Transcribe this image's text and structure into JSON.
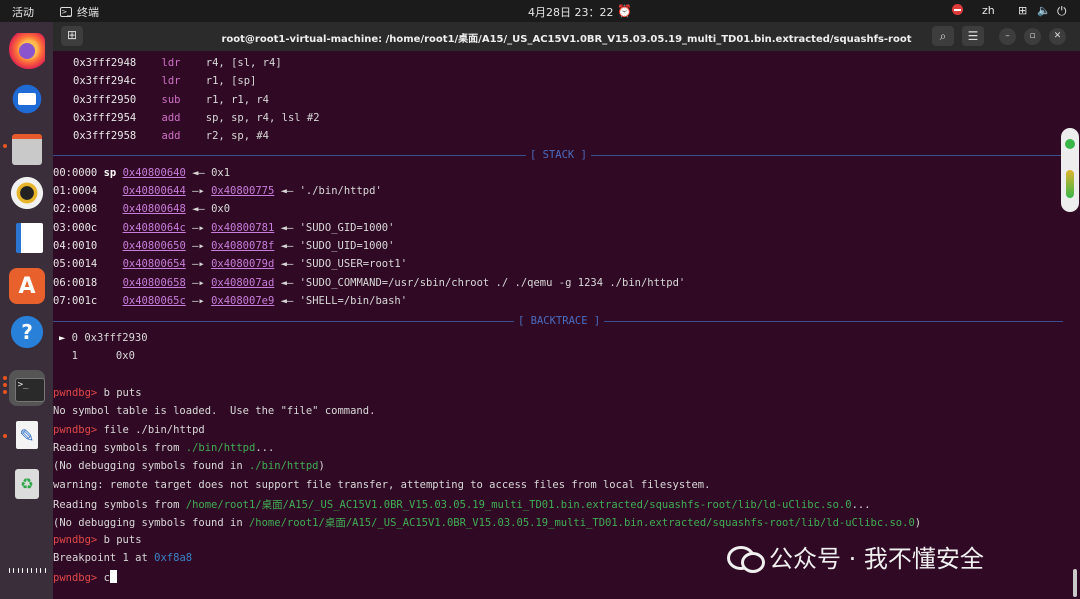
{
  "topbar": {
    "activities": "活动",
    "app_name": "终端",
    "clock": "4月28日 23：22",
    "lang": "zh"
  },
  "window": {
    "title": "root@root1-virtual-machine: /home/root1/桌面/A15/_US_AC15V1.0BR_V15.03.05.19_multi_TD01.bin.extracted/squashfs-root"
  },
  "disasm": [
    {
      "addr": "0x3fff2948",
      "op": "ldr",
      "args": "r4, [sl, r4]"
    },
    {
      "addr": "0x3fff294c",
      "op": "ldr",
      "args": "r1, [sp]"
    },
    {
      "addr": "0x3fff2950",
      "op": "sub",
      "args": "r1, r1, r4"
    },
    {
      "addr": "0x3fff2954",
      "op": "add",
      "args": "sp, sp, r4, lsl #2"
    },
    {
      "addr": "0x3fff2958",
      "op": "add",
      "args": "r2, sp, #4"
    }
  ],
  "sections": {
    "stack": "[ STACK ]",
    "backtrace": "[ BACKTRACE ]"
  },
  "stack": [
    {
      "idx": "00:0000",
      "reg": "sp",
      "addr": "0x40800640",
      "target": "",
      "value": "0x1"
    },
    {
      "idx": "01:0004",
      "reg": "",
      "addr": "0x40800644",
      "target": "0x40800775",
      "value": "'./bin/httpd'"
    },
    {
      "idx": "02:0008",
      "reg": "",
      "addr": "0x40800648",
      "target": "",
      "value": "0x0"
    },
    {
      "idx": "03:000c",
      "reg": "",
      "addr": "0x4080064c",
      "target": "0x40800781",
      "value": "'SUDO_GID=1000'"
    },
    {
      "idx": "04:0010",
      "reg": "",
      "addr": "0x40800650",
      "target": "0x4080078f",
      "value": "'SUDO_UID=1000'"
    },
    {
      "idx": "05:0014",
      "reg": "",
      "addr": "0x40800654",
      "target": "0x4080079d",
      "value": "'SUDO_USER=root1'"
    },
    {
      "idx": "06:0018",
      "reg": "",
      "addr": "0x40800658",
      "target": "0x408007ad",
      "value": "'SUDO_COMMAND=/usr/sbin/chroot ./ ./qemu -g 1234 ./bin/httpd'"
    },
    {
      "idx": "07:001c",
      "reg": "",
      "addr": "0x4080065c",
      "target": "0x408007e9",
      "value": "'SHELL=/bin/bash'"
    }
  ],
  "backtrace": [
    {
      "marker": "►",
      "frame": "0",
      "addr": "0x3fff2930"
    },
    {
      "marker": "",
      "frame": "1",
      "addr": "0x0"
    }
  ],
  "console": {
    "prompt": "pwndbg>",
    "cmd1": " b puts",
    "msg1": "No symbol table is loaded.  Use the \"file\" command.",
    "cmd2": " file ./bin/httpd",
    "read1_pre": "Reading symbols from ",
    "read1_path": "./bin/httpd",
    "read1_post": "...",
    "nodbg1_pre": "(No debugging symbols found in ",
    "nodbg1_path": "./bin/httpd",
    "nodbg1_post": ")",
    "warning": "warning: remote target does not support file transfer, attempting to access files from local filesystem.",
    "read2_pre": "Reading symbols from ",
    "read2_path": "/home/root1/桌面/A15/_US_AC15V1.0BR_V15.03.05.19_multi_TD01.bin.extracted/squashfs-root/lib/ld-uClibc.so.0",
    "read2_post": "...",
    "nodbg2_pre": "(No debugging symbols found in ",
    "nodbg2_path": "/home/root1/桌面/A15/_US_AC15V1.0BR_V15.03.05.19_multi_TD01.bin.extracted/squashfs-root/lib/ld-uClibc.so.0",
    "nodbg2_post": ")",
    "cmd3": " b puts",
    "bp_pre": "Breakpoint 1 at ",
    "bp_addr": "0xf8a8",
    "cmd4": " c"
  },
  "watermark": "公众号 · 我不懂安全",
  "icons": {
    "dock": [
      "firefox-icon",
      "thunderbird-icon",
      "files-icon",
      "rhythmbox-icon",
      "writer-icon",
      "app-center-icon",
      "help-icon",
      "terminal-icon",
      "text-editor-icon",
      "trash-icon",
      "show-apps-icon"
    ]
  },
  "colors": {
    "terminal_bg": "#300a24",
    "prompt": "#e14848",
    "path": "#3fae54",
    "address": "#c77ddb",
    "section": "#4a6cc0"
  }
}
